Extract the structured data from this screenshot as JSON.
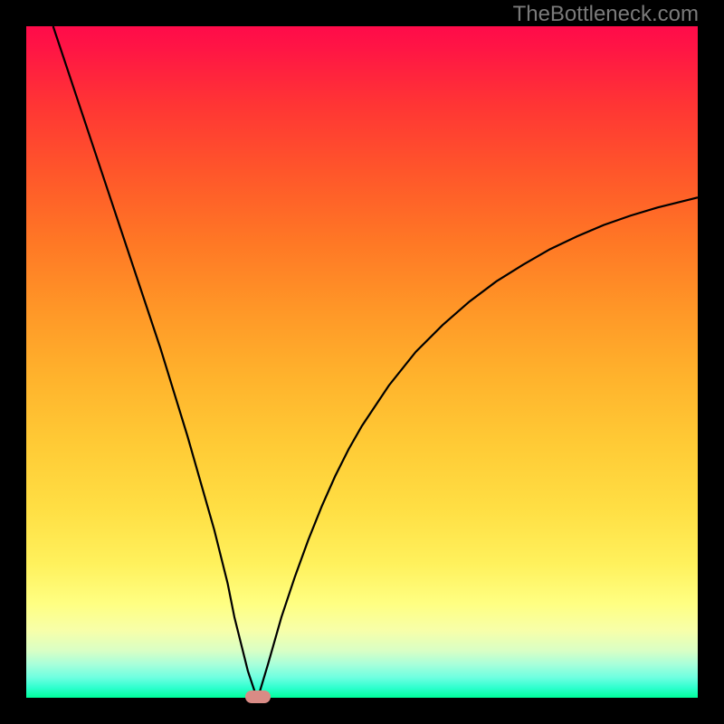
{
  "attribution": "TheBottleneck.com",
  "chart_data": {
    "type": "line",
    "title": "",
    "xlabel": "",
    "ylabel": "",
    "xlim": [
      0,
      100
    ],
    "ylim": [
      0,
      100
    ],
    "x": [
      4,
      6,
      8,
      10,
      12,
      14,
      16,
      18,
      20,
      22,
      24,
      26,
      28,
      30,
      31,
      32,
      33,
      34,
      34.5,
      36,
      38,
      40,
      42,
      44,
      46,
      48,
      50,
      54,
      58,
      62,
      66,
      70,
      74,
      78,
      82,
      86,
      90,
      94,
      98,
      100
    ],
    "values": [
      100,
      94,
      88,
      82,
      76,
      70,
      64,
      58,
      52,
      45.5,
      39,
      32,
      25,
      17,
      12,
      8,
      4,
      1,
      0,
      5,
      12,
      18,
      23.5,
      28.5,
      33,
      37,
      40.5,
      46.5,
      51.5,
      55.5,
      59,
      62,
      64.5,
      66.8,
      68.7,
      70.4,
      71.8,
      73,
      74,
      74.5
    ],
    "marker_x": 34.5,
    "gradient_colors": {
      "top": "#ff0b4a",
      "middle": "#ffdf44",
      "bottom": "#00ff9c"
    }
  }
}
